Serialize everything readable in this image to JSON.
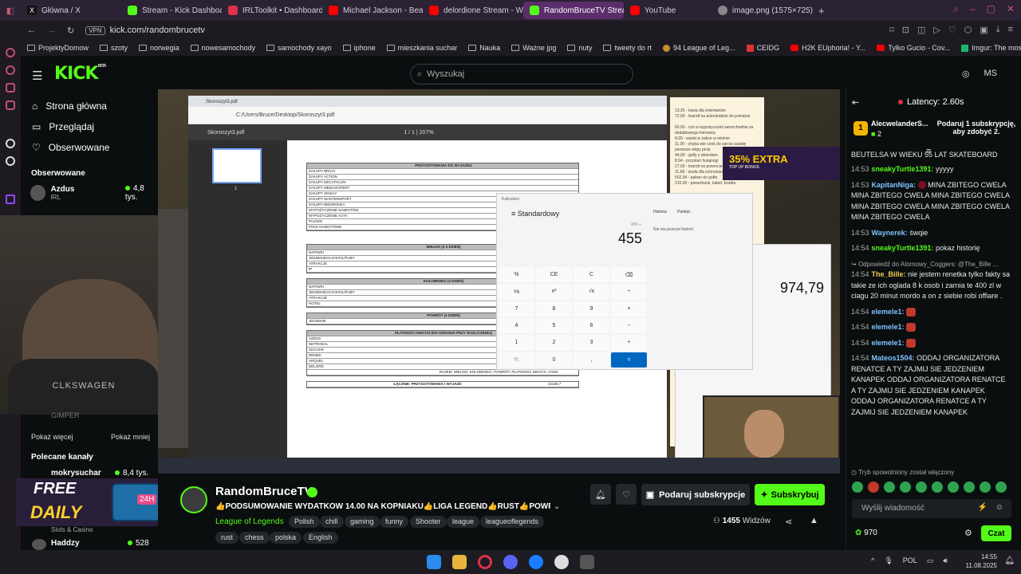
{
  "browser": {
    "tabs": [
      {
        "label": "Główna / X",
        "fav": "#222222"
      },
      {
        "label": "Stream - Kick Dashboard",
        "fav": "#53fc18"
      },
      {
        "label": "IRLToolkit • Dashboard",
        "fav": "#e0304a"
      },
      {
        "label": "Michael Jackson - Beat It",
        "fav": "#ff0000"
      },
      {
        "label": "delordione Stream - Wat...",
        "fav": "#ff0000"
      },
      {
        "label": "RandomBruceTV Stream",
        "fav": "#53fc18"
      },
      {
        "label": "YouTube",
        "fav": "#ff0000"
      },
      {
        "label": "image.png (1575×725)",
        "fav": "#888888"
      }
    ],
    "vpn": "VPN",
    "url": "kick.com/randombrucetv",
    "bookmarks": [
      "ProjektyDomow",
      "szoty",
      "norwegia",
      "nowesamochody",
      "samochody xayo",
      "iphone",
      "mieszkania suchar",
      "Nauka",
      "Ważne jpg",
      "nuty",
      "tweety do rt",
      "94 League of Leg...",
      "CEIDG",
      "H2K EUphoria! - Y...",
      "Tylko Gucio - Cov...",
      "Imgur: The most a..."
    ]
  },
  "header": {
    "logo": "KICK",
    "logo_sup": "BETA",
    "search_placeholder": "Wyszukaj",
    "right_label": "MS"
  },
  "sidebar": {
    "nav": [
      "Strona główna",
      "Przeglądaj",
      "Obserwowane"
    ],
    "followed_title": "Obserwowane",
    "followed": {
      "name": "Azdus",
      "category": "IRL",
      "viewers": "4,8 tys."
    },
    "show_more": "Pokaż więcej",
    "show_less": "Pokaż mniej",
    "recommended_title": "Polecane kanały",
    "recommended": [
      {
        "name": "mokrysuchar",
        "category": "Slots & Casino",
        "viewers": "8,4 tys."
      },
      {
        "name": "Haddzy",
        "viewers": "528"
      }
    ],
    "ghost": "GIMPER"
  },
  "video": {
    "pdf_title": "Skoroszyt3.pdf",
    "pdf_path": "C:/Users/Bruce/Desktop/Skoroszyt3.pdf",
    "pdf_page": "1 / 1",
    "pdf_zoom": "207%",
    "pdf_page_num": "1",
    "sections": [
      "PRZYGOTOWANIA DO WYJAZDU",
      "MIELNO (2-3 DZIEŃ)",
      "KOŁOBRZEG (3 DZIEŃ)",
      "POWRÓT (4 DZIEŃ)",
      "PŁATNOŚCI INNYCH (DO ODDANIA PRZY ROZLICZENIU)"
    ],
    "rows1": [
      "ZAKUPY BRICO",
      "ZAKUPY ACTION",
      "ZAKUPY DECATHLON",
      "ZAKUPY MEDIAEXPERT",
      "ZAKUPY SINSAY",
      "ZAKUPY MARTENSPORT",
      "ZAKUPY BIEDRONKA",
      "WYPOŻYCZENIE NAMIOTÓW",
      "WYPOŻYCZENIE AUTA",
      "PALIWO",
      "POLE NAMIOTOWE"
    ],
    "rows2": [
      "NAPIWKI",
      "JEDZENIE/ALKOHOL/PUBY",
      "ATRAKCJE",
      "IP"
    ],
    "rows3": [
      "NAPIWKI",
      "JEDZENIE/ALKOHOL/PUBY",
      "ATRAKCJE",
      "HOTEL"
    ],
    "rows4": [
      "JEDZENIE"
    ],
    "rows5": [
      "AZDUS",
      "NETRODAL",
      "SUCHAR",
      "REMEK",
      "ARQUEL",
      "DELORD"
    ],
    "razem": "RAZEM: MIELNO, KOLOBRZEG, POWRÓT, PŁATNOŚCI INNYCH",
    "razem_val": "17293",
    "lacznie": "ŁĄCZNIE: PRZYGOTOWANIA I WYJAZD",
    "lacznie_val": "24185,7",
    "notes": [
      "13:25 - kawa dla entertainion",
      "72,00 - brandt na autostradzie do pomania",
      "",
      "60,00 - coś w wypożyczalni samochodów za dodatkowego kierowcę",
      "8,99 - wanki w żabce w mielnie",
      "11,00 - chyba wie cook do zarcia zastały pierwsze ekipy picia",
      "44,00 - golfy z delordem",
      "8,94 - przystań hulajnogi",
      "27,00 - brandt na powrocie",
      "11,68 - woda dla ochroniarza",
      "502,94 - paliwo do golfa",
      "210,00 - powerbank, kabel, kostka"
    ],
    "promo": "35% EXTRA",
    "promo_sub": "TOP UP BONUS",
    "calc1": {
      "title": "Kalkulator",
      "mode": "Standardowy",
      "hist": "Historia",
      "mem": "Pamięć",
      "history_empty": "Nie ma jeszcze historii",
      "expr": "455 +",
      "display": "455"
    },
    "calc2": {
      "display": "974,79"
    },
    "shirt": "CLKSWAGEN"
  },
  "stream": {
    "channel": "RandomBruceTV",
    "title": "👍PODSUMOWANIE WYDATKÓW 14.00 NA KOPNIAKU👍LIGA LEGEND👍RUST👍POWRÓ...",
    "category": "League of Legends",
    "tags": [
      "Polish",
      "chill",
      "gaming",
      "funny",
      "Shooter",
      "league",
      "leagueoflegends",
      "rust",
      "chess",
      "polska",
      "English"
    ],
    "gift_label": "Podaruj subskrypcje",
    "sub_label": "Subskrybuj",
    "viewers": "1455",
    "viewers_label": "Widzów"
  },
  "chat": {
    "latency": "Latency: 2.60s",
    "sub_user": "AlecwelanderS...",
    "sub_count": "2",
    "sub_cta": "Podaruj 1 subskrypcję, aby zdobyć 2.",
    "messages": [
      {
        "t": "",
        "u": "",
        "c": "#e8e8e8",
        "text": "BEUTELSA W WIEKU 55 LAT SKATEBOARD"
      },
      {
        "t": "14:53",
        "u": "sneakyTurtle1391:",
        "c": "#53fc18",
        "text": "yyyyy"
      },
      {
        "t": "14:53",
        "u": "KapitanNiga:",
        "c": "#7ec3ff",
        "text": "MINA ZBITEGO CWELA MINA ZBITEGO CWELA MINA ZBITEGO CWELA MINA ZBITEGO CWELA MINA ZBITEGO CWELA MINA ZBITEGO CWELA"
      },
      {
        "t": "14:53",
        "u": "Waynerek:",
        "c": "#7ec3ff",
        "text": "śwqie"
      },
      {
        "t": "14:54",
        "u": "sneakyTurtle1391:",
        "c": "#53fc18",
        "text": "pokaz historię"
      },
      {
        "t": "",
        "u": "",
        "c": "#aaa",
        "text": "Odpowiedź do Atomowy_Coggers: @The_Bille ..."
      },
      {
        "t": "14:54",
        "u": "The_Bille:",
        "c": "#f2c94c",
        "text": "nie jestem renetka tylko fakty sa takie ze ich oglada 8 k osob i zarnia te 400 zl w ciagu 20 minut mordo a on z siebie robi offiare ."
      },
      {
        "t": "14:54",
        "u": "elemele1:",
        "c": "#7ec3ff",
        "text": ""
      },
      {
        "t": "14:54",
        "u": "elemele1:",
        "c": "#7ec3ff",
        "text": ""
      },
      {
        "t": "14:54",
        "u": "elemele1:",
        "c": "#7ec3ff",
        "text": ""
      },
      {
        "t": "14:54",
        "u": "Mateos1504:",
        "c": "#7ec3ff",
        "text": "ODDAJ ORGANIZATORA RENATCE A TY ZAJMIJ SIE JEDZENIEM KANAPEK ODDAJ ORGANIZATORA RENATCE A TY ZAJMIJ SIE JEDZENIEM KANAPEK ODDAJ ORGANIZATORA RENATCE A TY ZAJMIJ SIE JEDZENIEM KANAPEK"
      }
    ],
    "slow_mode": "Tryb spowolniony został włączony",
    "input_placeholder": "Wyślij wiadomość",
    "points": "970",
    "send_label": "Czat"
  },
  "taskbar": {
    "time": "14:55",
    "date": "11.08.2025",
    "lang": "POL"
  },
  "overlay": {
    "daily1": "FREE",
    "daily2": "DAILY",
    "chest_label": "24H"
  }
}
